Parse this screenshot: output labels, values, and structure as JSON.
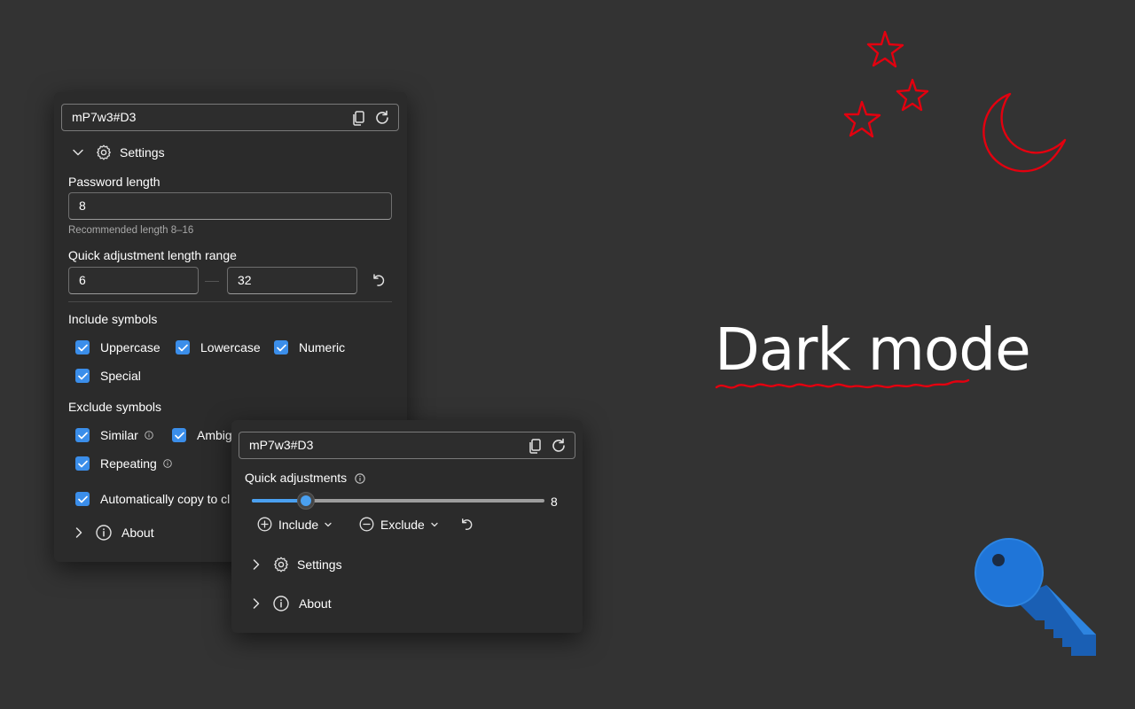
{
  "colors": {
    "background": "#333333",
    "panel": "#2b2b2b",
    "accent": "#3b8eea",
    "doodle": "#e3000f",
    "key": "#1f6fd0"
  },
  "main_panel": {
    "password": "mP7w3#D3",
    "settings_label": "Settings",
    "password_length_label": "Password length",
    "password_length_value": "8",
    "password_length_hint": "Recommended length 8–16",
    "quick_range_label": "Quick adjustment length range",
    "range_min": "6",
    "range_max": "32",
    "include_label": "Include symbols",
    "include": [
      {
        "label": "Uppercase",
        "checked": true
      },
      {
        "label": "Lowercase",
        "checked": true
      },
      {
        "label": "Numeric",
        "checked": true
      },
      {
        "label": "Special",
        "checked": true
      }
    ],
    "exclude_label": "Exclude symbols",
    "exclude": [
      {
        "label": "Similar",
        "checked": true
      },
      {
        "label": "Ambig",
        "checked": true
      },
      {
        "label": "Repeating",
        "checked": true
      }
    ],
    "auto_copy_label": "Automatically copy to cl",
    "about_label": "About"
  },
  "popup_panel": {
    "password": "mP7w3#D3",
    "quick_adjustments_label": "Quick adjustments",
    "slider_value": "8",
    "slider_fraction": 0.07,
    "include_button": "Include",
    "exclude_button": "Exclude",
    "settings_label": "Settings",
    "about_label": "About"
  },
  "hero_text": "Dark mode",
  "icons": [
    "copy-icon",
    "refresh-icon",
    "chevron-down-icon",
    "chevron-right-icon",
    "gear-icon",
    "info-icon",
    "undo-icon",
    "plus-circle-icon",
    "minus-circle-icon",
    "key-icon",
    "star-icon",
    "moon-icon"
  ]
}
